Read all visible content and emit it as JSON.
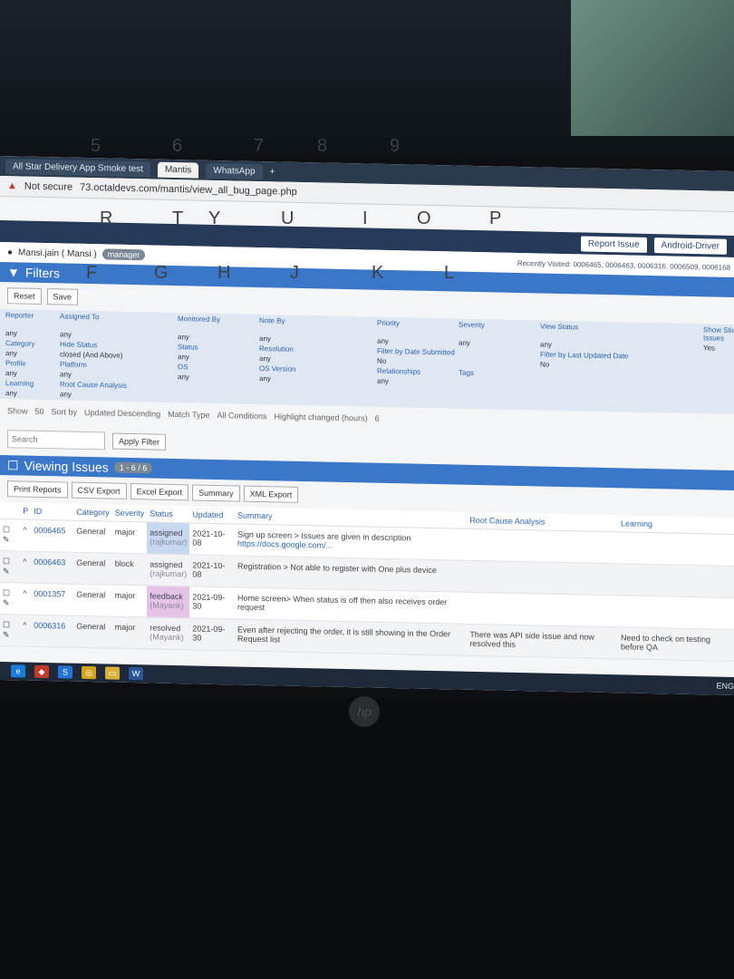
{
  "browser": {
    "tabs": [
      "All Star Delivery App Smoke test",
      "Mantis",
      "WhatsApp"
    ],
    "address_prefix": "Not secure",
    "url": "73.octaldevs.com/mantis/view_all_bug_page.php"
  },
  "navbar": {
    "report_issue": "Report Issue",
    "project": "Android-Driver"
  },
  "user": {
    "name": "Mansi.jain ( Mansi )",
    "role": "manager",
    "recent": "Recently Visited: 0006465, 0006463, 0006316, 0006509, 0006168"
  },
  "filters": {
    "title": "Filters",
    "reset": "Reset",
    "save": "Save",
    "cells": [
      "Reporter",
      "Assigned To",
      "Monitored By",
      "Note By",
      "Priority",
      "Severity",
      "View Status",
      "Show Sticky Issues",
      "any",
      "any",
      "any",
      "any",
      "any",
      "any",
      "any",
      "Yes",
      "Category",
      "Hide Status",
      "Status",
      "Resolution",
      "Filter by Date Submitted",
      "",
      "Filter by Last Updated Date",
      "",
      "any",
      "closed (And Above)",
      "any",
      "any",
      "No",
      "",
      "No",
      "",
      "Profile",
      "Platform",
      "OS",
      "OS Version",
      "Relationships",
      "Tags",
      "",
      "",
      "any",
      "any",
      "any",
      "any",
      "any",
      "",
      "",
      "",
      "Learning",
      "Root Cause Analysis",
      "",
      "",
      "",
      "",
      "",
      "",
      "any",
      "any",
      "",
      "",
      "",
      "",
      "",
      ""
    ],
    "show_label": "Show",
    "show_value": "50",
    "sort_label": "Sort by",
    "sort_value": "Updated Descending",
    "match_label": "Match Type",
    "match_value": "All Conditions",
    "highlight_label": "Highlight changed (hours)",
    "highlight_value": "6",
    "search_placeholder": "Search",
    "apply": "Apply Filter"
  },
  "viewing": {
    "title": "Viewing Issues",
    "count": "1 - 6 / 6",
    "exports": [
      "Print Reports",
      "CSV Export",
      "Excel Export",
      "Summary",
      "XML Export"
    ],
    "columns": [
      "P",
      "ID",
      "",
      "Category",
      "Severity",
      "Status",
      "Updated",
      "Summary",
      "Root Cause Analysis",
      "Learning"
    ],
    "rows": [
      {
        "id": "0006465",
        "cat": "General",
        "sev": "major",
        "status": "assigned",
        "who": "(rajkumar)",
        "updated": "2021-10-08",
        "summary": "Sign up screen > Issues are given in description",
        "summary2": "https://docs.google.com/...",
        "rca": "",
        "learn": ""
      },
      {
        "id": "0006463",
        "cat": "General",
        "sev": "block",
        "status": "assigned",
        "who": "(rajkumar)",
        "updated": "2021-10-08",
        "summary": "Registration > Not able to register with One plus device",
        "summary2": "",
        "rca": "",
        "learn": ""
      },
      {
        "id": "0001357",
        "cat": "General",
        "sev": "major",
        "status": "feedback",
        "who": "(Mayank)",
        "updated": "2021-09-30",
        "summary": "Home screen> When status is off then also receives order request",
        "summary2": "",
        "rca": "",
        "learn": ""
      },
      {
        "id": "0006316",
        "cat": "General",
        "sev": "major",
        "status": "resolved",
        "who": "(Mayank)",
        "updated": "2021-09-30",
        "summary": "Even after rejecting the order, it is still showing in the Order Request list",
        "summary2": "",
        "rca": "There was API side issue and now resolved this",
        "learn": "Need to check on testing before QA"
      }
    ]
  },
  "taskbar": {
    "lang": "ENG"
  },
  "keyboard": {
    "keys": [
      "5",
      "6",
      "7",
      "8",
      "9",
      "R",
      "T",
      "Y",
      "U",
      "I",
      "O",
      "P",
      "F",
      "G",
      "H",
      "J",
      "K",
      "L"
    ],
    "brand": "hp"
  }
}
